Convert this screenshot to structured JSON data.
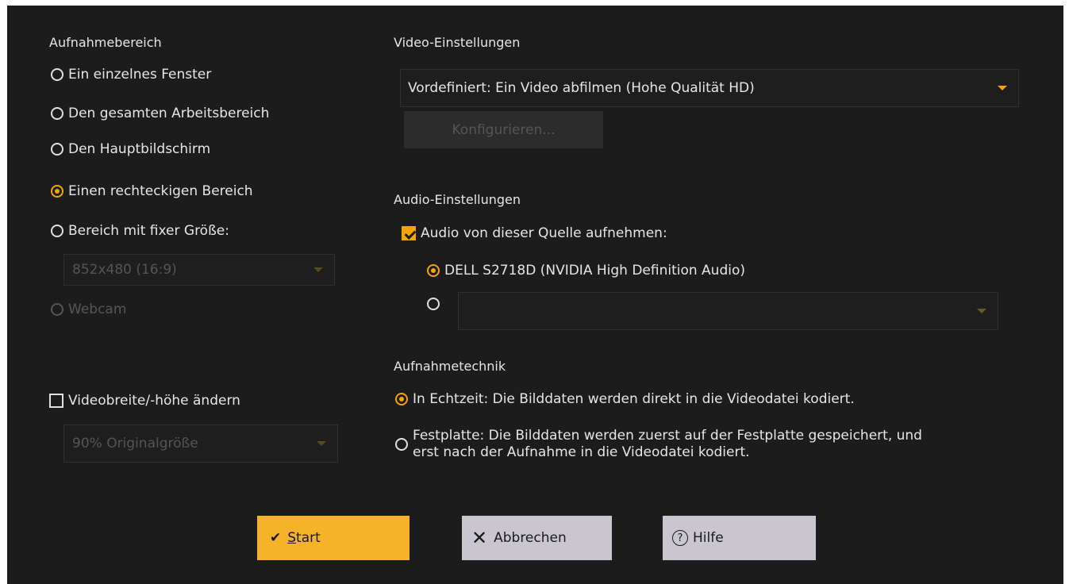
{
  "capture_area": {
    "title": "Aufnahmebereich",
    "options": [
      {
        "label": "Ein einzelnes Fenster",
        "checked": false
      },
      {
        "label": "Den gesamten Arbeitsbereich",
        "checked": false
      },
      {
        "label": "Den Hauptbildschirm",
        "checked": false
      },
      {
        "label": "Einen rechteckigen Bereich",
        "checked": true
      },
      {
        "label": "Bereich mit fixer Größe:",
        "checked": false
      }
    ],
    "fixed_size_value": "852x480 (16:9)",
    "webcam_label": "Webcam"
  },
  "resize": {
    "checkbox_label": "Videobreite/-höhe ändern",
    "checked": false,
    "size_value": "90% Originalgröße"
  },
  "video": {
    "title": "Video-Einstellungen",
    "preset_value": "Vordefiniert: Ein Video abfilmen (Hohe Qualität HD)",
    "configure_label": "Konfigurieren..."
  },
  "audio": {
    "title": "Audio-Einstellungen",
    "record_label": "Audio von dieser Quelle aufnehmen:",
    "record_checked": true,
    "source_label": "DELL S2718D (NVIDIA High Definition Audio)",
    "other_source_value": ""
  },
  "technique": {
    "title": "Aufnahmetechnik",
    "realtime_label": "In Echtzeit: Die Bilddaten werden direkt in die Videodatei kodiert.",
    "disk_label_line1": "Festplatte: Die Bilddaten werden zuerst auf der Festplatte gespeichert, und",
    "disk_label_line2": "erst nach der Aufnahme in die Videodatei kodiert."
  },
  "buttons": {
    "start_mnemonic": "S",
    "start_rest": "tart",
    "cancel": "Abbrechen",
    "help": "Hilfe"
  },
  "colors": {
    "accent": "#f5a400",
    "background": "#1c1c1c",
    "secondary_button": "#c9c6d0"
  }
}
